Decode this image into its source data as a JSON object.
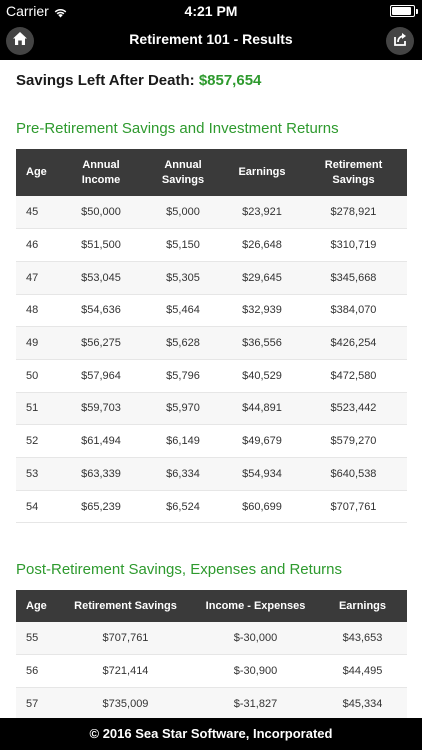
{
  "status_bar": {
    "carrier": "Carrier",
    "time": "4:21 PM",
    "battery_level": 0.9
  },
  "nav": {
    "title": "Retirement 101 - Results",
    "left_icon": "home-icon",
    "right_icon": "share-icon"
  },
  "summary": {
    "label": "Savings Left After Death:",
    "value": "$857,654"
  },
  "pre": {
    "title": "Pre-Retirement Savings and Investment Returns",
    "headers": {
      "age": "Age",
      "income_1": "Annual",
      "income_2": "Income",
      "savings_1": "Annual",
      "savings_2": "Savings",
      "earnings": "Earnings",
      "retirement_1": "Retirement",
      "retirement_2": "Savings"
    },
    "rows": [
      [
        "45",
        "$50,000",
        "$5,000",
        "$23,921",
        "$278,921"
      ],
      [
        "46",
        "$51,500",
        "$5,150",
        "$26,648",
        "$310,719"
      ],
      [
        "47",
        "$53,045",
        "$5,305",
        "$29,645",
        "$345,668"
      ],
      [
        "48",
        "$54,636",
        "$5,464",
        "$32,939",
        "$384,070"
      ],
      [
        "49",
        "$56,275",
        "$5,628",
        "$36,556",
        "$426,254"
      ],
      [
        "50",
        "$57,964",
        "$5,796",
        "$40,529",
        "$472,580"
      ],
      [
        "51",
        "$59,703",
        "$5,970",
        "$44,891",
        "$523,442"
      ],
      [
        "52",
        "$61,494",
        "$6,149",
        "$49,679",
        "$579,270"
      ],
      [
        "53",
        "$63,339",
        "$6,334",
        "$54,934",
        "$640,538"
      ],
      [
        "54",
        "$65,239",
        "$6,524",
        "$60,699",
        "$707,761"
      ]
    ]
  },
  "post": {
    "title": "Post-Retirement Savings, Expenses and Returns",
    "headers": {
      "age": "Age",
      "savings": "Retirement Savings",
      "income_expenses": "Income - Expenses",
      "earnings": "Earnings"
    },
    "rows": [
      [
        "55",
        "$707,761",
        "$-30,000",
        "$43,653"
      ],
      [
        "56",
        "$721,414",
        "$-30,900",
        "$44,495"
      ],
      [
        "57",
        "$735,009",
        "$-31,827",
        "$45,334"
      ]
    ]
  },
  "footer": {
    "text": "© 2016 Sea Star Software, Incorporated"
  }
}
